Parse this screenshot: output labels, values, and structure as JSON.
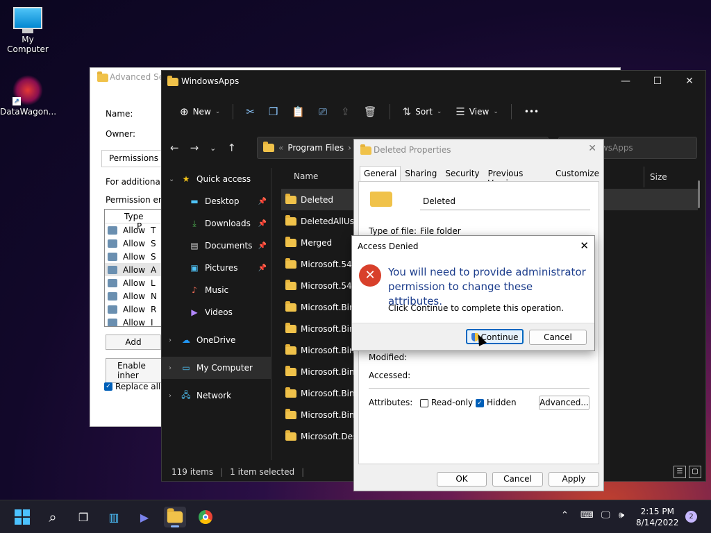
{
  "desktop": {
    "icons": [
      {
        "label": "My Computer",
        "icon": "monitor-icon"
      },
      {
        "label": "DataWagon...",
        "icon": "datawagon-icon"
      }
    ]
  },
  "advanced_security": {
    "title": "Advanced Sec",
    "name_label": "Name:",
    "owner_label": "Owner:",
    "permissions_tab": "Permissions",
    "info_text": "For additional i",
    "entries_label": "Permission ent",
    "list_header_type": "Type",
    "list_header_p": "P",
    "rows": [
      {
        "type": "Allow",
        "p": "T"
      },
      {
        "type": "Allow",
        "p": "S"
      },
      {
        "type": "Allow",
        "p": "S"
      },
      {
        "type": "Allow",
        "p": "A"
      },
      {
        "type": "Allow",
        "p": "L"
      },
      {
        "type": "Allow",
        "p": "N"
      },
      {
        "type": "Allow",
        "p": "R"
      },
      {
        "type": "Allow",
        "p": "I"
      }
    ],
    "add_button": "Add",
    "enable_inherit_button": "Enable inher",
    "replace_all_label": "Replace all c"
  },
  "explorer": {
    "title": "WindowsApps",
    "toolbar": {
      "new": "New",
      "sort": "Sort",
      "view": "View",
      "more": "•••"
    },
    "address": {
      "prefix": "«",
      "crumb": "Program Files",
      "sep": "›"
    },
    "search_placeholder": "h WindowsApps",
    "nav": [
      {
        "label": "Quick access",
        "icon": "star-icon",
        "level": "top",
        "chev": "⌄"
      },
      {
        "label": "Desktop",
        "icon": "desktop-icon",
        "level": "sub",
        "pinned": true
      },
      {
        "label": "Downloads",
        "icon": "download-icon",
        "level": "sub",
        "pinned": true
      },
      {
        "label": "Documents",
        "icon": "documents-icon",
        "level": "sub",
        "pinned": true
      },
      {
        "label": "Pictures",
        "icon": "pictures-icon",
        "level": "sub",
        "pinned": true
      },
      {
        "label": "Music",
        "icon": "music-icon",
        "level": "sub"
      },
      {
        "label": "Videos",
        "icon": "videos-icon",
        "level": "sub"
      },
      {
        "label": "OneDrive",
        "icon": "cloud-icon",
        "level": "top",
        "chev": "›"
      },
      {
        "label": "My Computer",
        "icon": "computer-icon",
        "level": "top",
        "chev": "›",
        "selected": true
      },
      {
        "label": "Network",
        "icon": "network-icon",
        "level": "top",
        "chev": "›"
      }
    ],
    "column_name": "Name",
    "column_size": "Size",
    "files": [
      "Deleted",
      "DeletedAllUseri",
      "Merged",
      "Microsoft.5499",
      "Microsoft.5499",
      "Microsoft.Bing",
      "Microsoft.Bing",
      "Microsoft.Bing",
      "Microsoft.Bing",
      "Microsoft.Bing",
      "Microsoft.Bing",
      "Microsoft.Desk"
    ],
    "status_items": "119 items",
    "status_selected": "1 item selected"
  },
  "properties": {
    "title": "Deleted Properties",
    "tabs": [
      "General",
      "Sharing",
      "Security",
      "Previous Versions",
      "Customize"
    ],
    "folder_name": "Deleted",
    "type_label": "Type of file:",
    "type_value": "File folder",
    "modified_label": "Modified:",
    "accessed_label": "Accessed:",
    "attributes_label": "Attributes:",
    "readonly_label": "Read-only",
    "hidden_label": "Hidden",
    "advanced_button": "Advanced...",
    "ok_button": "OK",
    "cancel_button": "Cancel",
    "apply_button": "Apply"
  },
  "access_denied": {
    "title": "Access Denied",
    "message": "You will need to provide administrator permission to change these attributes.",
    "sub": "Click Continue to complete this operation.",
    "continue_button": "Continue",
    "cancel_button": "Cancel"
  },
  "taskbar": {
    "time": "2:15 PM",
    "date": "8/14/2022",
    "notification_count": "2"
  },
  "colors": {
    "accent": "#0067c0",
    "error": "#d8402b",
    "folder": "#f0c24a",
    "dialog_text": "#1c3d8c"
  }
}
